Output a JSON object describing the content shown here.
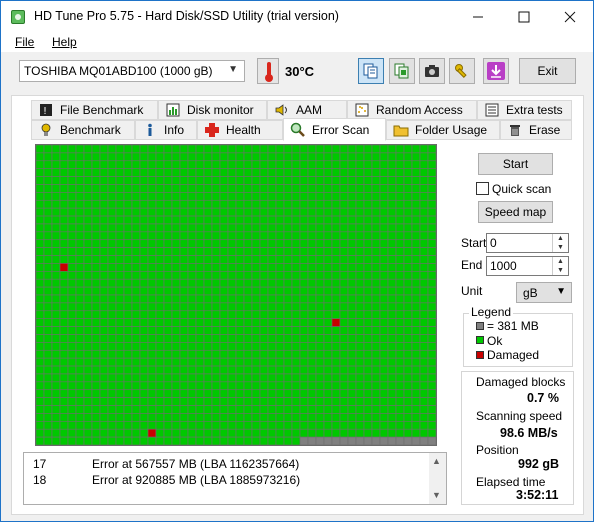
{
  "window": {
    "title": "HD Tune Pro 5.75 - Hard Disk/SSD Utility (trial version)"
  },
  "menu": {
    "file": "File",
    "help": "Help"
  },
  "toolbar": {
    "drive": "TOSHIBA MQ01ABD100 (1000 gB)",
    "temperature": "30°C",
    "exit_label": "Exit"
  },
  "tabs": {
    "row1": [
      "File Benchmark",
      "Disk monitor",
      "AAM",
      "Random Access",
      "Extra tests"
    ],
    "row2": [
      "Benchmark",
      "Info",
      "Health",
      "Error Scan",
      "Folder Usage",
      "Erase"
    ],
    "selected": "Error Scan"
  },
  "scan": {
    "columns": 50,
    "rows": 38,
    "damaged_blocks": [
      [
        3,
        15
      ],
      [
        37,
        22
      ],
      [
        14,
        36
      ]
    ],
    "unscanned_from_row": 37,
    "unscanned_from_col": 33,
    "colors": {
      "ok": "#00c800",
      "damaged": "#c80000",
      "unscanned": "#808080",
      "grid": "#6f6f6f"
    }
  },
  "log": [
    {
      "num": "17",
      "msg": "Error at 567557 MB (LBA 1162357664)"
    },
    {
      "num": "18",
      "msg": "Error at 920885 MB (LBA 1885973216)"
    }
  ],
  "controls": {
    "start_label": "Start",
    "quick_scan_label": "Quick scan",
    "speed_map_label": "Speed map",
    "start_field_label": "Start",
    "start_value": "0",
    "end_field_label": "End",
    "end_value": "1000",
    "unit_label": "Unit",
    "unit_value": "gB"
  },
  "legend": {
    "title": "Legend",
    "block_size": "= 381 MB",
    "ok": "Ok",
    "damaged": "Damaged"
  },
  "stats": {
    "damaged_blocks_label": "Damaged blocks",
    "damaged_blocks_value": "0.7 %",
    "scanning_speed_label": "Scanning speed",
    "scanning_speed_value": "98.6 MB/s",
    "position_label": "Position",
    "position_value": "992 gB",
    "elapsed_label": "Elapsed time",
    "elapsed_value": "3:52:11"
  }
}
